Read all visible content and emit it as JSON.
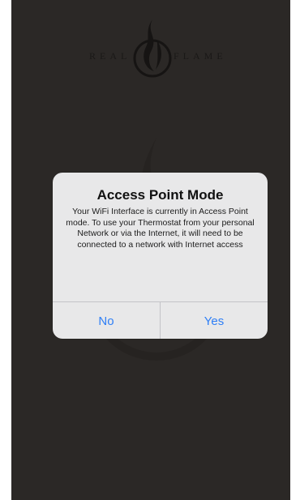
{
  "header": {
    "logo_left": "REAL",
    "logo_right": "FLAME",
    "logo_icon": "flame-icon"
  },
  "background": {
    "watermark_icon": "flame-watermark-icon"
  },
  "alert": {
    "title": "Access Point Mode",
    "message": "Your WiFi Interface is currently in Access Point mode. To use your Thermostat from your personal Network or via the Internet, it will need to be connected to a network with Internet access",
    "buttons": {
      "no_label": "No",
      "yes_label": "Yes"
    }
  },
  "colors": {
    "background": "#2b2826",
    "alert_bg": "#eeeef0",
    "button_text": "#2f7ff6"
  }
}
